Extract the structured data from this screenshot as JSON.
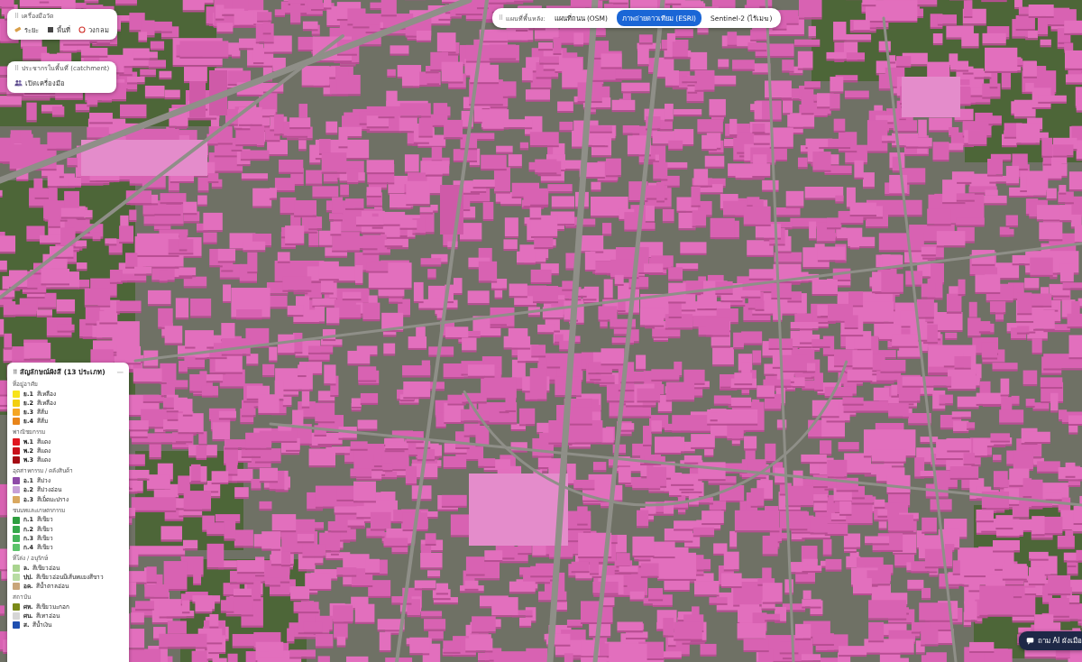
{
  "measure_panel": {
    "grip": "⠿",
    "title": "เครื่องมือวัด",
    "tools": [
      {
        "label": "ระยะ",
        "kind": "ruler"
      },
      {
        "label": "พื้นที่",
        "kind": "square"
      },
      {
        "label": "วงกลม",
        "kind": "circle"
      }
    ]
  },
  "catchment_panel": {
    "grip": "⠿",
    "title": "ประชากรในพื้นที่ (catchment)",
    "button": "เปิดเครื่องมือ"
  },
  "basemap": {
    "grip": "⠿",
    "label": "แผนที่พื้นหลัง:",
    "tabs": [
      {
        "label": "แผนที่ถนน (OSM)",
        "selected": false
      },
      {
        "label": "ภาพถ่ายดาวเทียม (ESRI)",
        "selected": true
      },
      {
        "label": "Sentinel-2 (ไร้เมฆ)",
        "selected": false
      }
    ]
  },
  "legend": {
    "grip": "⠿",
    "title": "สัญลักษณ์ผังสี (13 ประเภท)",
    "collapse": "—",
    "groups": [
      {
        "title": "ที่อยู่อาศัย",
        "items": [
          {
            "code": "ย.1",
            "label": "สีเหลือง",
            "color": "#f7e31a"
          },
          {
            "code": "ย.2",
            "label": "สีเหลือง",
            "color": "#f2cf0f"
          },
          {
            "code": "ย.3",
            "label": "สีส้ม",
            "color": "#f5a623"
          },
          {
            "code": "ย.4",
            "label": "สีส้ม",
            "color": "#e8851a"
          }
        ]
      },
      {
        "title": "พาณิชยกรรม",
        "items": [
          {
            "code": "พ.1",
            "label": "สีแดง",
            "color": "#e0161f"
          },
          {
            "code": "พ.2",
            "label": "สีแดง",
            "color": "#c8101a"
          },
          {
            "code": "พ.3",
            "label": "สีแดง",
            "color": "#a50c14"
          }
        ]
      },
      {
        "title": "อุตสาหกรรม / คลังสินค้า",
        "items": [
          {
            "code": "อ.1",
            "label": "สีม่วง",
            "color": "#8e4aa8"
          },
          {
            "code": "อ.2",
            "label": "สีม่วงอ่อน",
            "color": "#c7a0d8"
          },
          {
            "code": "อ.3",
            "label": "สีเม็ดมะปราง",
            "color": "#d9a860"
          }
        ]
      },
      {
        "title": "ชนบทและเกษตรกรรม",
        "items": [
          {
            "code": "ก.1",
            "label": "สีเขียว",
            "color": "#2e9e3f"
          },
          {
            "code": "ก.2",
            "label": "สีเขียว",
            "color": "#35a84a"
          },
          {
            "code": "ก.3",
            "label": "สีเขียว",
            "color": "#45b55a"
          },
          {
            "code": "ก.4",
            "label": "สีเขียว",
            "color": "#5cc46b"
          }
        ]
      },
      {
        "title": "ที่โล่ง / อนุรักษ์",
        "items": [
          {
            "code": "ล.",
            "label": "สีเขียวอ่อน",
            "color": "#a9d48f"
          },
          {
            "code": "ปป.",
            "label": "สีเขียวอ่อนมีเส้นทแยงสีขาว",
            "color": "#b8dca3"
          },
          {
            "code": "อค.",
            "label": "สีน้ำตาลอ่อน",
            "color": "#c9a57a"
          }
        ]
      },
      {
        "title": "สถาบัน",
        "items": [
          {
            "code": "ศห.",
            "label": "สีเขียวมะกอก",
            "color": "#7a8a18"
          },
          {
            "code": "ศน.",
            "label": "สีเทาอ่อน",
            "color": "#d6d6d6"
          },
          {
            "code": "ส.",
            "label": "สีน้ำเงิน",
            "color": "#1f4fb0"
          }
        ]
      }
    ]
  },
  "ai_button": {
    "label": "ถาม AI ผังเมือ"
  }
}
